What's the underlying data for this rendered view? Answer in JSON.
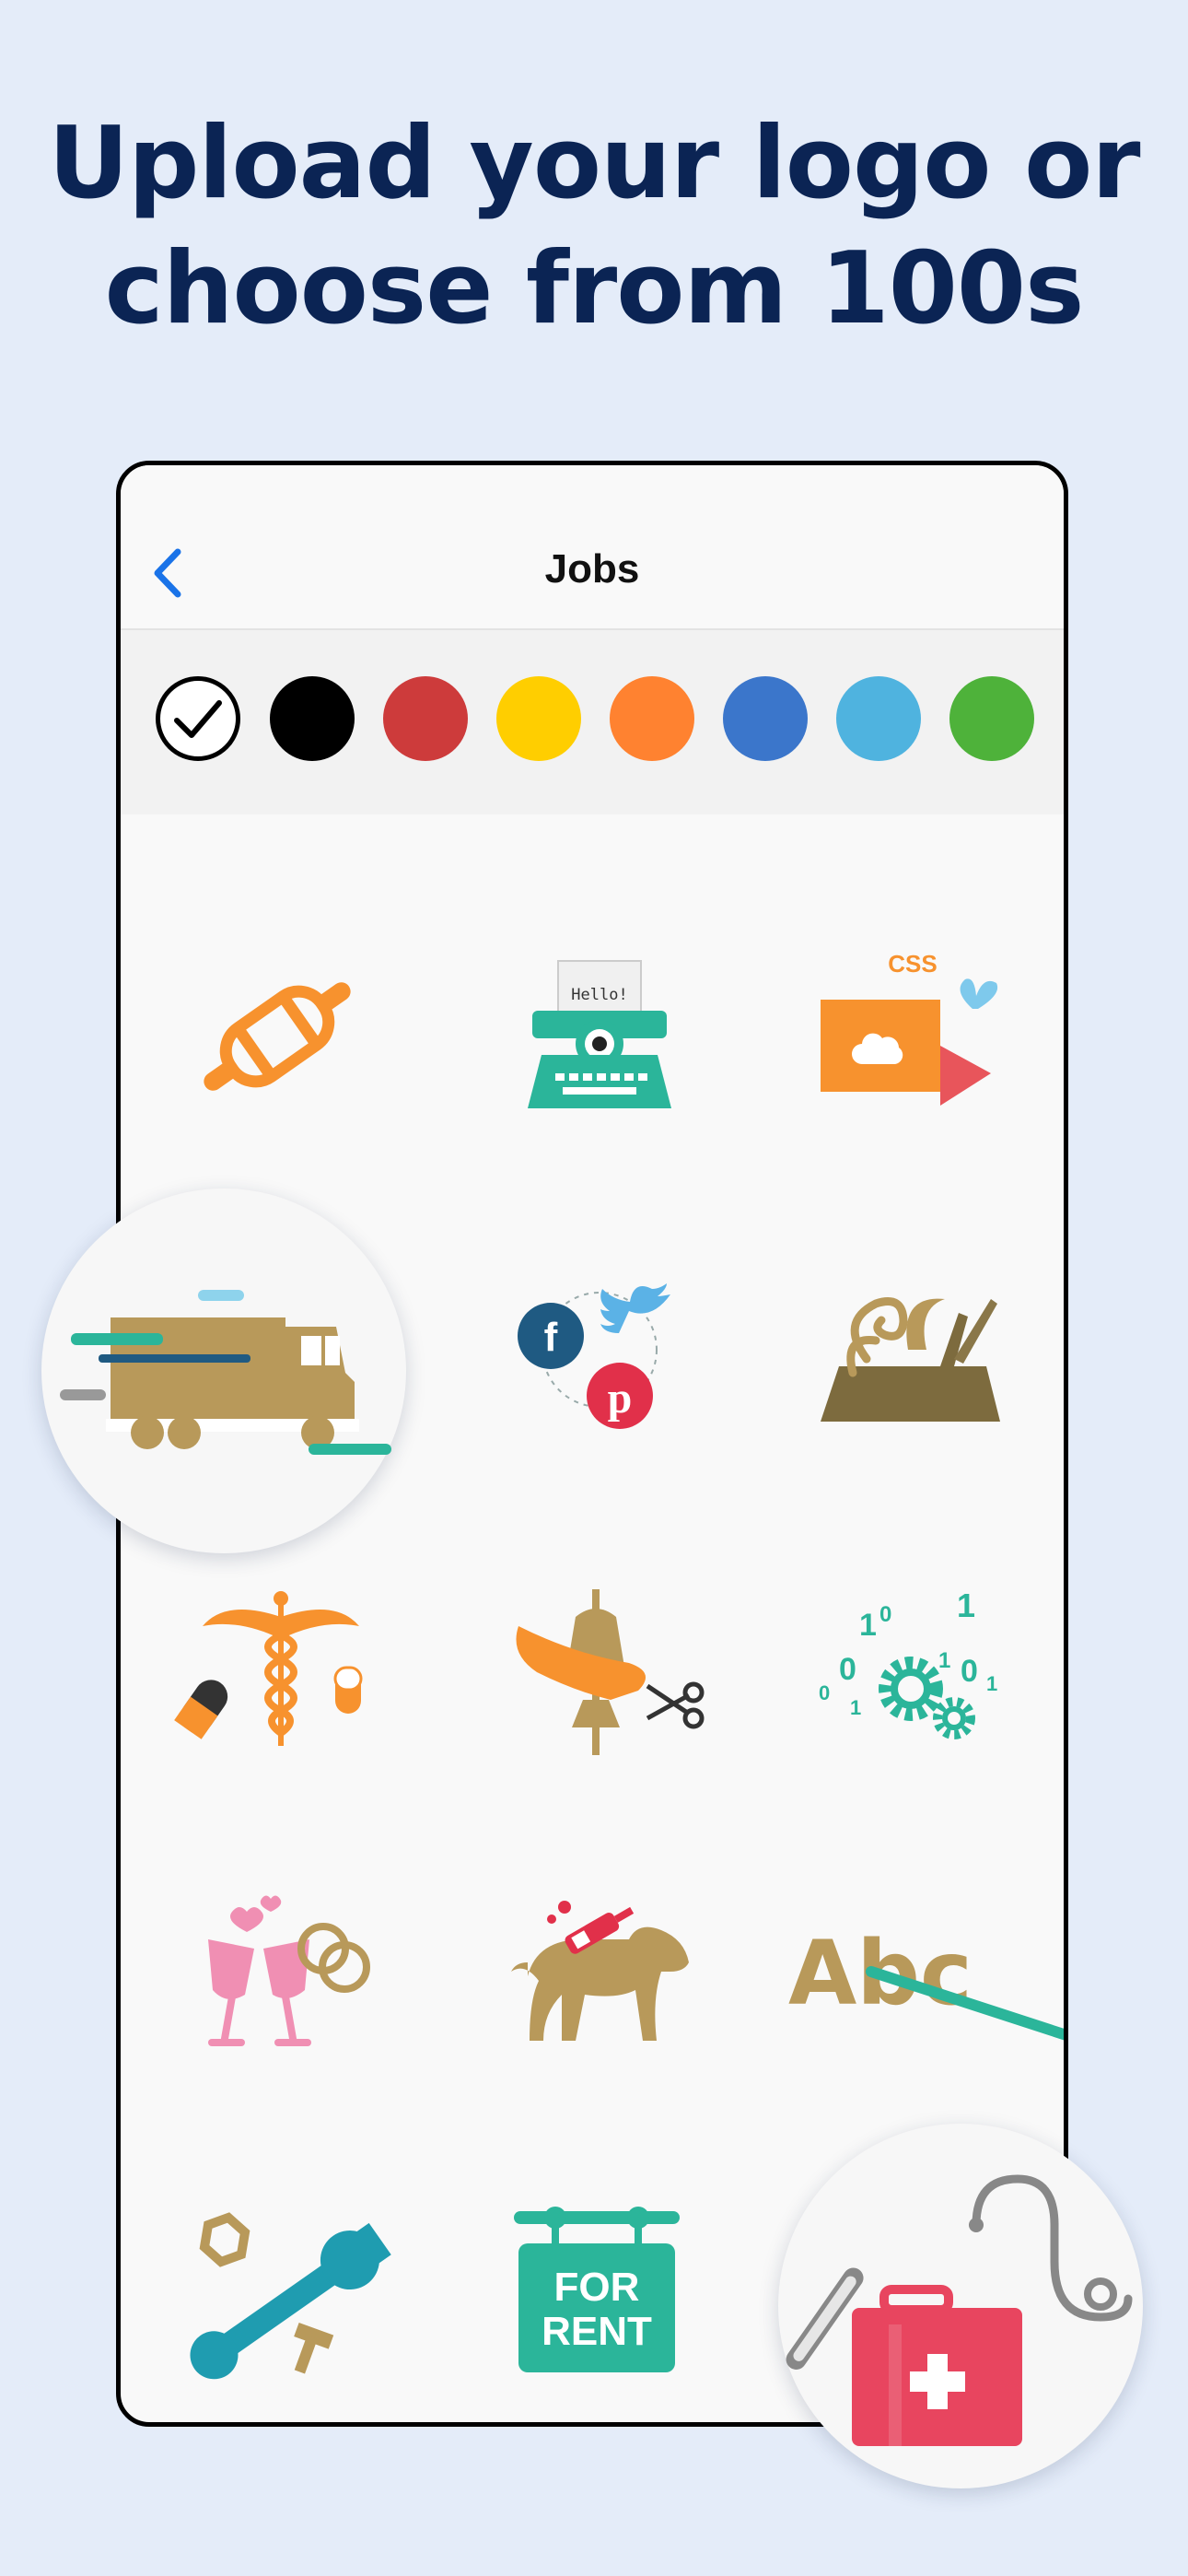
{
  "headline": {
    "line1": "Upload your logo or",
    "line2": "choose from 100s"
  },
  "nav": {
    "title": "Jobs",
    "back_icon": "chevron-left-icon",
    "back_color": "#1a73e8"
  },
  "colors": [
    {
      "name": "selected-check",
      "hex": "#ffffff"
    },
    {
      "name": "black",
      "hex": "#000000"
    },
    {
      "name": "red",
      "hex": "#cd3b3b"
    },
    {
      "name": "yellow",
      "hex": "#ffce00"
    },
    {
      "name": "orange",
      "hex": "#ff8230"
    },
    {
      "name": "blue",
      "hex": "#3b76cb"
    },
    {
      "name": "light-blue",
      "hex": "#4fb3df"
    },
    {
      "name": "green",
      "hex": "#4eb23a"
    }
  ],
  "icons": {
    "typewriter_paper_text": "Hello!",
    "laptop_caption": "CSS",
    "letters": "Abc",
    "sign_line1": "FOR",
    "sign_line2": "RENT",
    "binary_digits": [
      "1",
      "0",
      "1",
      "0",
      "1",
      "0",
      "1",
      "0",
      "1"
    ]
  },
  "icon_names": [
    "rolling-pin-icon",
    "typewriter-icon",
    "laptop-css-icon",
    "delivery-truck-icon",
    "social-media-icon",
    "wood-plane-icon",
    "caduceus-pills-icon",
    "tailor-mannequin-icon",
    "binary-gears-icon",
    "champagne-rings-icon",
    "dog-grooming-icon",
    "abc-teaching-icon",
    "wrench-tools-icon",
    "for-rent-sign-icon",
    "medical-kit-icon"
  ]
}
